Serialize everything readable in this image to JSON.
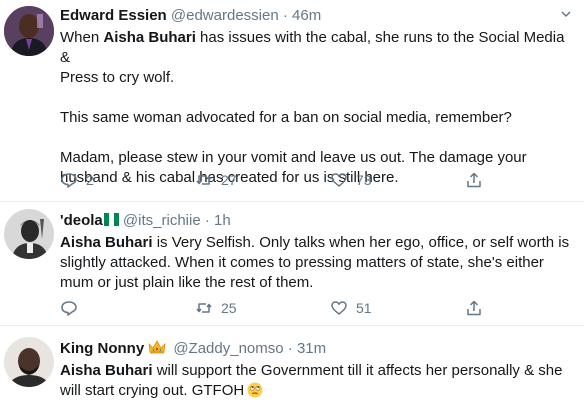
{
  "tweets": [
    {
      "name": "Edward Essien",
      "handle": "@edwardessien",
      "time": "46m",
      "text": {
        "l1_pre": "When ",
        "l1_bold": "Aisha Buhari",
        "l1_post": " has issues with the cabal, she runs to the Social Media &",
        "l2": "Press to cry wolf.",
        "p2": "This same woman advocated for a ban on social media, remember?",
        "p3a": "Madam, please stew in your vomit and leave us out. The damage your",
        "p3b": "husband & his cabal has created for us is still here."
      },
      "reply_count": "2",
      "retweet_count": "27",
      "like_count": "73"
    },
    {
      "name": "'deola",
      "handle": "@its_richiie",
      "time": "1h",
      "text": {
        "bold": "Aisha Buhari",
        "l1_post": " is Very Selfish. Only talks when her ego, office, or self worth is",
        "l2": "slightly attacked. When it comes to pressing matters of state, she's either",
        "l3": "mum or just plain like the rest of them."
      },
      "retweet_count": "25",
      "like_count": "51"
    },
    {
      "name": "King Nonny",
      "handle": "@Zaddy_nomso",
      "time": "31m",
      "text": {
        "bold": "Aisha Buhari",
        "l1_post": " will support the Government till it affects her personally & she",
        "l2": "will start crying out. GTFOH"
      }
    }
  ],
  "dot": "·",
  "icons": {
    "reply": "reply-icon",
    "retweet": "retweet-icon",
    "like": "heart-icon",
    "share": "share-icon",
    "caret": "chevron-down-icon",
    "flag": "nigeria-flag-icon",
    "crown": "crown-icon",
    "eye_roll": "eye-roll-emoji-icon"
  },
  "colors": {
    "text": "#14171a",
    "secondary": "#657786",
    "divider": "#e6ecf0"
  }
}
